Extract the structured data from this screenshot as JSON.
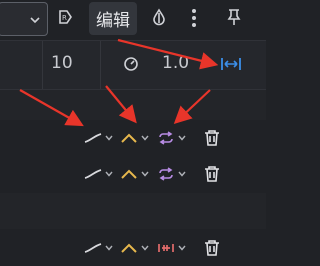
{
  "toolbar": {
    "edit_label": "编辑",
    "icons": [
      "chevron-down-icon",
      "record-tag-icon",
      "drop-icon",
      "more-vertical-icon",
      "pin-icon"
    ]
  },
  "params": {
    "value_a": "10",
    "value_b": "1.0",
    "icons": [
      "timer-icon",
      "fit-width-icon"
    ]
  },
  "tracks": [
    {
      "line": "curve",
      "ease": "caret",
      "loop": "loop",
      "delete": "trash"
    },
    {
      "line": "curve",
      "ease": "caret",
      "loop": "loop",
      "delete": "trash"
    },
    {
      "line": "curve",
      "ease": "caret",
      "loop": "bounded",
      "delete": "trash"
    }
  ],
  "colors": {
    "accent_blue": "#3b8ee8",
    "annotation_red": "#e8352a",
    "ease_yellow": "#e7b84d",
    "loop_purple": "#b98de6",
    "bounded_red": "#e26b6b"
  }
}
